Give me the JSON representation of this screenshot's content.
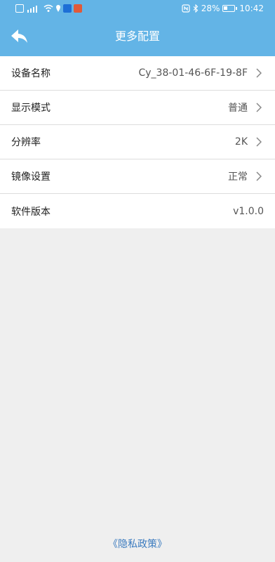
{
  "status_bar": {
    "battery_text": "28%",
    "time": "10:42"
  },
  "header": {
    "title": "更多配置"
  },
  "settings": [
    {
      "label": "设备名称",
      "value": "Cy_38-01-46-6F-19-8F",
      "has_chevron": true
    },
    {
      "label": "显示模式",
      "value": "普通",
      "has_chevron": true
    },
    {
      "label": "分辨率",
      "value": "2K",
      "has_chevron": true
    },
    {
      "label": "镜像设置",
      "value": "正常",
      "has_chevron": true
    },
    {
      "label": "软件版本",
      "value": "v1.0.0",
      "has_chevron": false
    }
  ],
  "footer": {
    "privacy_link": "《隐私政策》"
  },
  "colors": {
    "header_bg": "#63b4e6",
    "page_bg": "#efefef",
    "link": "#3b7bbf"
  }
}
